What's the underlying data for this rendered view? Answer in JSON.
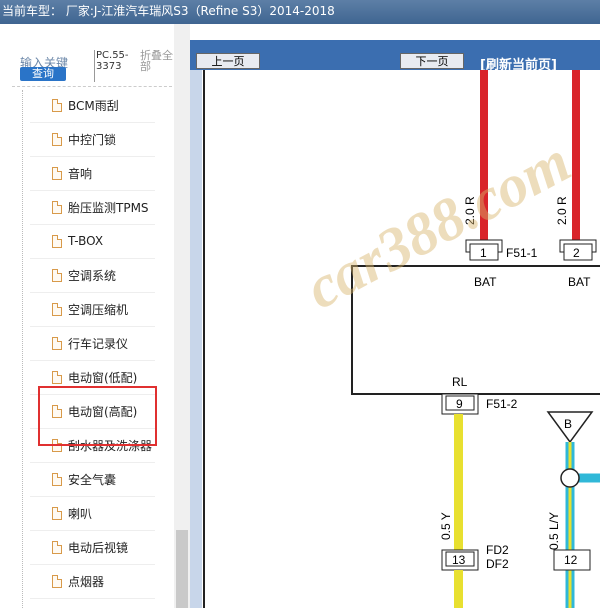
{
  "topbar": {
    "title": "当前车型：  厂家:J-江淮汽车瑞风S3（Refine S3）2014-2018"
  },
  "search": {
    "label": "输入关键",
    "button": "查询",
    "pc": "PC.55-3373",
    "fold": "折叠全部"
  },
  "tree": {
    "items": [
      {
        "label": "BCM雨刮"
      },
      {
        "label": "中控门锁"
      },
      {
        "label": "音响"
      },
      {
        "label": "胎压监测TPMS"
      },
      {
        "label": "T-BOX"
      },
      {
        "label": "空调系统"
      },
      {
        "label": "空调压缩机"
      },
      {
        "label": "行车记录仪"
      },
      {
        "label": "电动窗(低配)"
      },
      {
        "label": "电动窗(高配)"
      },
      {
        "label": "刮水器及洗涤器"
      },
      {
        "label": "安全气囊"
      },
      {
        "label": "喇叭"
      },
      {
        "label": "电动后视镜"
      },
      {
        "label": "点烟器"
      }
    ]
  },
  "nav": {
    "prev": "上一页",
    "next": "下一页",
    "refresh": "[刷新当前页]"
  },
  "diagram": {
    "wire1": "2.0 R",
    "wire2": "2.0 R",
    "pin1": "1",
    "pin1_conn": "F51-1",
    "pin1_name": "BAT",
    "pin2": "2",
    "pin2_name": "BAT",
    "rl": "RL",
    "pin9": "9",
    "pin9_conn": "F51-2",
    "node_b": "B",
    "wire3": "0.5 Y",
    "wire4": "0.5 L/Y",
    "pin13": "13",
    "fd2": "FD2",
    "df2": "DF2",
    "pin12": "12",
    "watermark": "car388.com"
  },
  "colors": {
    "red_wire": "#d9242a",
    "yellow_wire": "#e8e030",
    "cyan_wire": "#30b8d8",
    "nav_blue": "#3b6eb0"
  }
}
